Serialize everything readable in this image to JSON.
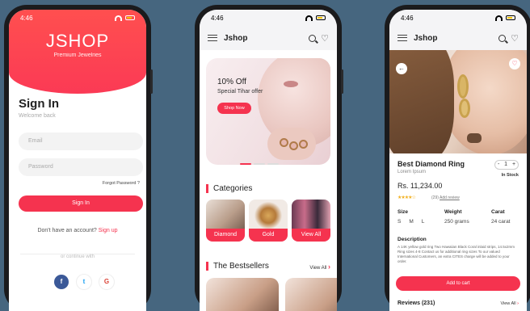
{
  "colors": {
    "accent": "#f5334f",
    "background": "#46667f"
  },
  "status_time": "4:46",
  "login": {
    "brand": "JSHOP",
    "tagline": "Premium Jewelries",
    "title": "Sign In",
    "subtitle": "Welcome back",
    "email_placeholder": "Email",
    "password_placeholder": "Password",
    "forgot": "Forgot Password ?",
    "signin_button": "Sign In",
    "no_account": "Don't have an account?",
    "signup": "Sign up",
    "continue_with": "or continue with",
    "social": [
      "f",
      "t",
      "G"
    ]
  },
  "home": {
    "app_title": "Jshop",
    "banner": {
      "headline": "10% Off",
      "offer": "Special Tihar offer",
      "button": "Shop Now"
    },
    "categories_title": "Categories",
    "categories": [
      "Diamond",
      "Gold",
      "View All"
    ],
    "bestsellers_title": "The Bestsellers",
    "view_all": "View All"
  },
  "product": {
    "app_title": "Jshop",
    "name": "Best Diamond Ring",
    "subtitle": "Lorem Ipsum",
    "price": "Rs. 11,234.00",
    "rating_stars": "★★★★☆",
    "review_count": "(29)",
    "add_review": "Add review",
    "qty_minus": "-",
    "qty": "1",
    "qty_plus": "+",
    "stock": "In Stock",
    "size_label": "Size",
    "sizes": [
      "S",
      "M",
      "L"
    ],
    "weight_label": "Weight",
    "weight": "250 grams",
    "carat_label": "Carat",
    "carat": "24 carat",
    "description_label": "Description",
    "description": "A 14K yellow gold ring Two Hawaiian Black Coral inlaid strips, 14.5x2mm Ring sizes 4-8 Contact us for additional ring sizes To our valued International Customers, an extra CITES charge will be added to your order.",
    "add_to_cart": "Add to cart",
    "reviews_label": "Reviews (231)",
    "view_all": "View All"
  }
}
